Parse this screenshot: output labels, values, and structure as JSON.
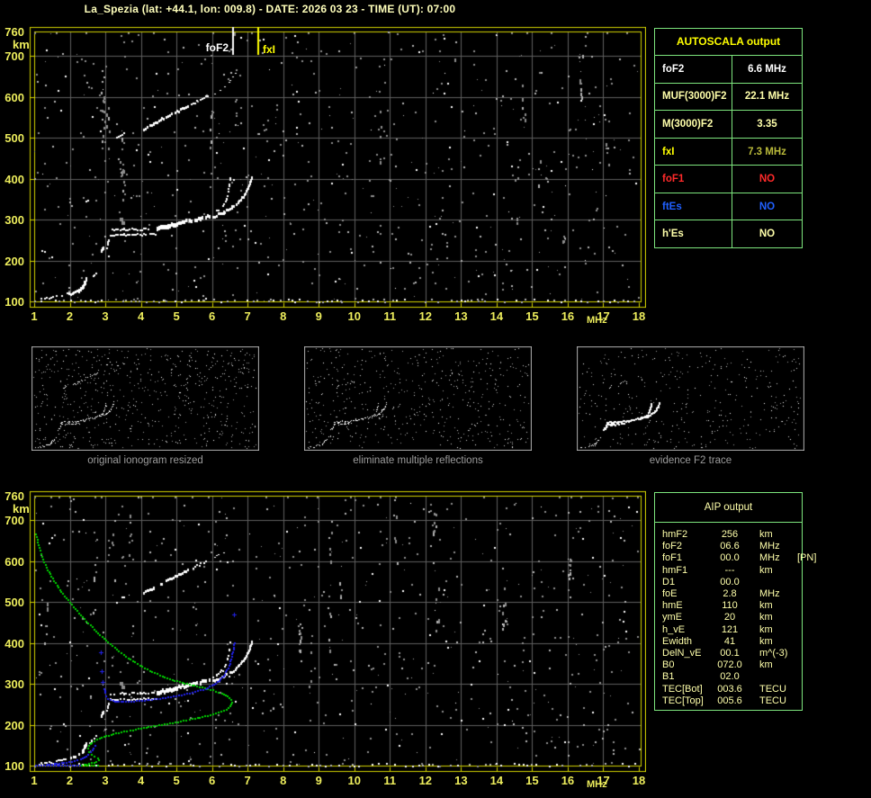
{
  "title": "La_Spezia (lat: +44.1, lon: 009.8) - DATE: 2026 03 23 - TIME (UT): 07:00",
  "colors": {
    "background": "#000000",
    "plot_border": "#d6d600",
    "grid": "#5f5f5f",
    "axis_text": "#eded5c",
    "title_text": "#ffffbb",
    "table_border": "#7de57d",
    "noise_gray": "#8e8e8e",
    "noise_light": "#b5b5b5",
    "trace_white": "#ffffff",
    "profile_green": "#00d400",
    "restored_blue": "#2222ee",
    "caption_gray": "#9c9c9c"
  },
  "autoscala_table": {
    "title": "AUTOSCALA output",
    "rows": [
      {
        "label": "foF2",
        "value": "6.6 MHz",
        "label_color": "#ffffff",
        "value_color": "#ffffff"
      },
      {
        "label": "MUF(3000)F2",
        "value": "22.1 MHz",
        "label_color": "#ffffaa",
        "value_color": "#ffffaa"
      },
      {
        "label": "M(3000)F2",
        "value": "3.35",
        "label_color": "#ffffaa",
        "value_color": "#ffffaa"
      },
      {
        "label": "fxI",
        "value": "7.3 MHz",
        "label_color": "#ffff00",
        "value_color": "#b9b93a"
      },
      {
        "label": "foF1",
        "value": "NO",
        "label_color": "#ff2a2a",
        "value_color": "#ff2a2a"
      },
      {
        "label": "ftEs",
        "value": "NO",
        "label_color": "#2060ff",
        "value_color": "#2060ff"
      },
      {
        "label": "h'Es",
        "value": "NO",
        "label_color": "#ffffaa",
        "value_color": "#ffffaa"
      }
    ]
  },
  "aip_table": {
    "title": "AIP output",
    "rows": [
      {
        "name": "hmF2",
        "value": "256",
        "unit": "km",
        "extra": ""
      },
      {
        "name": "foF2",
        "value": "06.6",
        "unit": "MHz",
        "extra": ""
      },
      {
        "name": "foF1",
        "value": "00.0",
        "unit": "MHz",
        "extra": "[PN]"
      },
      {
        "name": "hmF1",
        "value": "---",
        "unit": "km",
        "extra": ""
      },
      {
        "name": "D1",
        "value": "00.0",
        "unit": "",
        "extra": ""
      },
      {
        "name": "foE",
        "value": "2.8",
        "unit": "MHz",
        "extra": ""
      },
      {
        "name": "hmE",
        "value": "110",
        "unit": "km",
        "extra": ""
      },
      {
        "name": "ymE",
        "value": "20",
        "unit": "km",
        "extra": ""
      },
      {
        "name": "h_vE",
        "value": "121",
        "unit": "km",
        "extra": ""
      },
      {
        "name": "Ewidth",
        "value": "41",
        "unit": "km",
        "extra": ""
      },
      {
        "name": "DelN_vE",
        "value": "00.1",
        "unit": "m^(-3)",
        "extra": ""
      },
      {
        "name": "B0",
        "value": "072.0",
        "unit": "km",
        "extra": ""
      },
      {
        "name": "B1",
        "value": "02.0",
        "unit": "",
        "extra": ""
      },
      {
        "name": "TEC[Bot]",
        "value": "003.6",
        "unit": "TECU",
        "extra": ""
      },
      {
        "name": "TEC[Top]",
        "value": "005.6",
        "unit": "TECU",
        "extra": ""
      }
    ]
  },
  "thumbnails": [
    {
      "caption": "original ionogram resized"
    },
    {
      "caption": "eliminate multiple reflections"
    },
    {
      "caption": "evidence F2 trace"
    }
  ],
  "chart_data": [
    {
      "id": "main_ionogram",
      "type": "scatter",
      "title": "",
      "xlabel": "MHz",
      "ylabel": "km",
      "xlim": [
        1,
        18
      ],
      "ylim": [
        100,
        760
      ],
      "grid": true,
      "x_ticks": [
        1,
        2,
        3,
        4,
        5,
        6,
        7,
        8,
        9,
        10,
        11,
        12,
        13,
        14,
        15,
        16,
        17,
        18
      ],
      "y_ticks": [
        760,
        700,
        600,
        500,
        400,
        300,
        200,
        100
      ],
      "markers": [
        {
          "label": "foF2",
          "freq": 6.6,
          "color": "#ffffff"
        },
        {
          "label": "fxI",
          "freq": 7.3,
          "color": "#ffff00"
        }
      ],
      "traces": {
        "e_region": [
          {
            "w": 2,
            "dash": 0.45,
            "pts": [
              [
                1.12,
                104
              ],
              [
                1.45,
                109
              ],
              [
                1.75,
                115
              ],
              [
                1.95,
                119
              ]
            ]
          },
          {
            "w": 3,
            "dash": 0.25,
            "pts": [
              [
                1.95,
                118
              ],
              [
                2.1,
                122
              ],
              [
                2.25,
                127
              ]
            ]
          },
          {
            "w": 5,
            "dash": 0.15,
            "pts": [
              [
                2.25,
                124
              ],
              [
                2.33,
                133
              ],
              [
                2.4,
                143
              ],
              [
                2.45,
                152
              ]
            ]
          },
          {
            "w": 2,
            "dash": 0.55,
            "pts": [
              [
                2.48,
                152
              ],
              [
                2.6,
                160
              ],
              [
                2.72,
                170
              ]
            ]
          }
        ],
        "f_region": [
          {
            "w": 4,
            "dash": 0.0,
            "pts": [
              [
                2.86,
                222
              ],
              [
                2.93,
                231
              ]
            ]
          },
          {
            "w": 2,
            "dash": 0.2,
            "pts": [
              [
                3.02,
                230
              ],
              [
                3.06,
                244
              ],
              [
                3.1,
                257
              ]
            ]
          },
          {
            "w": 2,
            "dash": 0.1,
            "pts": [
              [
                3.12,
                261
              ],
              [
                3.5,
                262
              ],
              [
                3.95,
                263
              ],
              [
                4.4,
                264
              ]
            ]
          },
          {
            "w": 2,
            "dash": 0.3,
            "pts": [
              [
                3.12,
                275
              ],
              [
                3.5,
                276
              ],
              [
                3.95,
                276
              ],
              [
                4.35,
                277
              ]
            ]
          },
          {
            "w": 5,
            "dash": 0.0,
            "pts": [
              [
                4.45,
                278
              ],
              [
                4.75,
                284
              ],
              [
                5.0,
                289
              ]
            ]
          },
          {
            "w": 4,
            "dash": 0.12,
            "pts": [
              [
                5.05,
                291
              ],
              [
                5.35,
                297
              ],
              [
                5.65,
                303
              ],
              [
                5.9,
                309
              ]
            ]
          },
          {
            "w": 2,
            "dash": 0.35,
            "pts": [
              [
                5.95,
                312
              ],
              [
                6.12,
                321
              ],
              [
                6.28,
                334
              ],
              [
                6.38,
                350
              ],
              [
                6.44,
                368
              ],
              [
                6.47,
                385
              ],
              [
                6.5,
                400
              ]
            ]
          },
          {
            "w": 3,
            "dash": 0.05,
            "pts": [
              [
                6.0,
                307
              ],
              [
                6.3,
                317
              ],
              [
                6.55,
                329
              ],
              [
                6.75,
                344
              ],
              [
                6.9,
                360
              ],
              [
                7.0,
                377
              ],
              [
                7.07,
                395
              ],
              [
                7.1,
                404
              ]
            ]
          }
        ],
        "second_hop": [
          {
            "w": 2,
            "dash": 0.3,
            "pts": [
              [
                3.3,
                500
              ],
              [
                3.5,
                513
              ]
            ]
          },
          {
            "w": 3,
            "dash": 0.15,
            "pts": [
              [
                4.05,
                521
              ],
              [
                4.35,
                534
              ],
              [
                4.62,
                547
              ]
            ]
          },
          {
            "w": 3,
            "dash": 0.2,
            "pts": [
              [
                4.7,
                551
              ],
              [
                5.0,
                564
              ],
              [
                5.3,
                577
              ]
            ]
          },
          {
            "w": 2,
            "dash": 0.3,
            "pts": [
              [
                5.4,
                581
              ],
              [
                5.62,
                591
              ],
              [
                5.85,
                601
              ]
            ]
          },
          {
            "w": 1,
            "dash": 0.6,
            "pts": [
              [
                6.05,
                608
              ],
              [
                6.3,
                622
              ],
              [
                6.5,
                640
              ],
              [
                6.65,
                657
              ]
            ]
          }
        ],
        "smudges": [
          [
            3.4,
            305
          ],
          [
            3.45,
            295
          ]
        ]
      }
    },
    {
      "id": "profile_ionogram",
      "type": "scatter",
      "title": "",
      "xlabel": "MHz",
      "ylabel": "km",
      "xlim": [
        1,
        18
      ],
      "ylim": [
        100,
        760
      ],
      "grid": true,
      "x_ticks": [
        1,
        2,
        3,
        4,
        5,
        6,
        7,
        8,
        9,
        10,
        11,
        12,
        13,
        14,
        15,
        16,
        17,
        18
      ],
      "y_ticks": [
        760,
        700,
        600,
        500,
        400,
        300,
        200,
        100
      ],
      "traces_ref": "main_ionogram",
      "overlays": {
        "profile_green": [
          [
            1.03,
            668
          ],
          [
            1.1,
            641
          ],
          [
            1.2,
            613
          ],
          [
            1.33,
            586
          ],
          [
            1.5,
            559
          ],
          [
            1.7,
            532
          ],
          [
            1.93,
            506
          ],
          [
            2.18,
            480
          ],
          [
            2.45,
            455
          ],
          [
            2.72,
            430
          ],
          [
            3.0,
            407
          ],
          [
            3.3,
            385
          ],
          [
            3.62,
            365
          ],
          [
            3.95,
            347
          ],
          [
            4.3,
            331
          ],
          [
            4.65,
            318
          ],
          [
            5.0,
            308
          ],
          [
            5.35,
            300
          ],
          [
            5.7,
            293
          ],
          [
            6.0,
            286
          ],
          [
            6.25,
            279
          ],
          [
            6.42,
            271
          ],
          [
            6.52,
            263
          ],
          [
            6.55,
            256
          ],
          [
            6.5,
            247
          ],
          [
            6.38,
            239
          ],
          [
            6.15,
            231
          ],
          [
            5.85,
            224
          ],
          [
            5.5,
            217
          ],
          [
            5.1,
            210
          ],
          [
            4.65,
            203
          ],
          [
            4.2,
            196
          ],
          [
            3.75,
            189
          ],
          [
            3.35,
            182
          ],
          [
            3.0,
            174
          ],
          [
            2.75,
            166
          ],
          [
            2.6,
            158
          ],
          [
            2.52,
            150
          ],
          [
            2.5,
            143
          ],
          [
            2.53,
            136
          ],
          [
            2.6,
            129
          ],
          [
            2.68,
            124
          ],
          [
            2.76,
            119
          ],
          [
            2.8,
            115
          ],
          [
            2.72,
            111
          ],
          [
            2.6,
            108
          ],
          [
            2.45,
            105
          ],
          [
            2.33,
            103
          ]
        ],
        "restored_trace_blue": [
          [
            1.35,
            104
          ],
          [
            1.55,
            106
          ],
          [
            1.75,
            108
          ],
          [
            1.95,
            110
          ],
          [
            2.12,
            113
          ],
          [
            2.28,
            117
          ],
          [
            2.4,
            122
          ],
          [
            2.5,
            128
          ],
          [
            2.58,
            135
          ],
          [
            2.65,
            143
          ],
          [
            2.7,
            151
          ],
          [
            2.73,
            158
          ]
        ],
        "restored_f_blue": [
          [
            2.96,
            290
          ],
          [
            2.98,
            280
          ],
          [
            3.0,
            272
          ],
          [
            3.05,
            266
          ],
          [
            3.12,
            262
          ],
          [
            3.2,
            260
          ],
          [
            3.3,
            259
          ],
          [
            3.42,
            259
          ],
          [
            3.55,
            259
          ],
          [
            3.7,
            259
          ],
          [
            3.85,
            260
          ],
          [
            4.0,
            261
          ],
          [
            4.15,
            262
          ],
          [
            4.3,
            263
          ],
          [
            4.45,
            265
          ],
          [
            4.6,
            267
          ],
          [
            4.75,
            269
          ],
          [
            4.9,
            271
          ],
          [
            5.05,
            273
          ],
          [
            5.2,
            276
          ],
          [
            5.35,
            279
          ],
          [
            5.5,
            282
          ],
          [
            5.65,
            286
          ],
          [
            5.8,
            290
          ],
          [
            5.92,
            295
          ],
          [
            6.03,
            300
          ],
          [
            6.13,
            306
          ],
          [
            6.22,
            313
          ],
          [
            6.3,
            321
          ],
          [
            6.37,
            330
          ],
          [
            6.43,
            340
          ],
          [
            6.48,
            351
          ],
          [
            6.52,
            362
          ],
          [
            6.55,
            374
          ],
          [
            6.58,
            386
          ],
          [
            6.6,
            397
          ],
          [
            6.62,
            408
          ]
        ],
        "isolated_blue": [
          [
            2.88,
            378
          ],
          [
            2.9,
            330
          ],
          [
            2.93,
            305
          ],
          [
            6.62,
            470
          ]
        ],
        "baseline_km": 103,
        "baseline_blue_range": [
          1.02,
          2.3
        ],
        "baseline_green_range": [
          2.32,
          2.8
        ]
      }
    }
  ]
}
